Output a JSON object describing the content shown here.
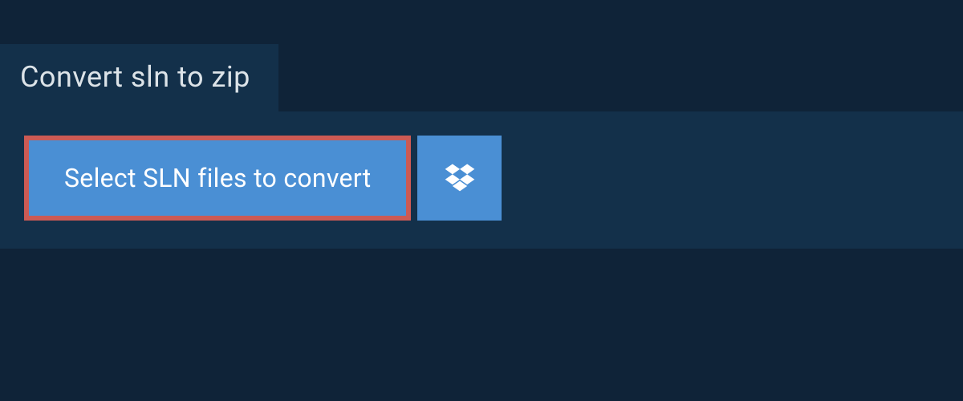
{
  "header": {
    "title": "Convert sln to zip"
  },
  "actions": {
    "select_files_label": "Select SLN files to convert"
  },
  "colors": {
    "page_bg": "#0f2338",
    "panel_bg": "#13304a",
    "button_bg": "#4a8fd4",
    "highlight_border": "#cc5a54"
  }
}
